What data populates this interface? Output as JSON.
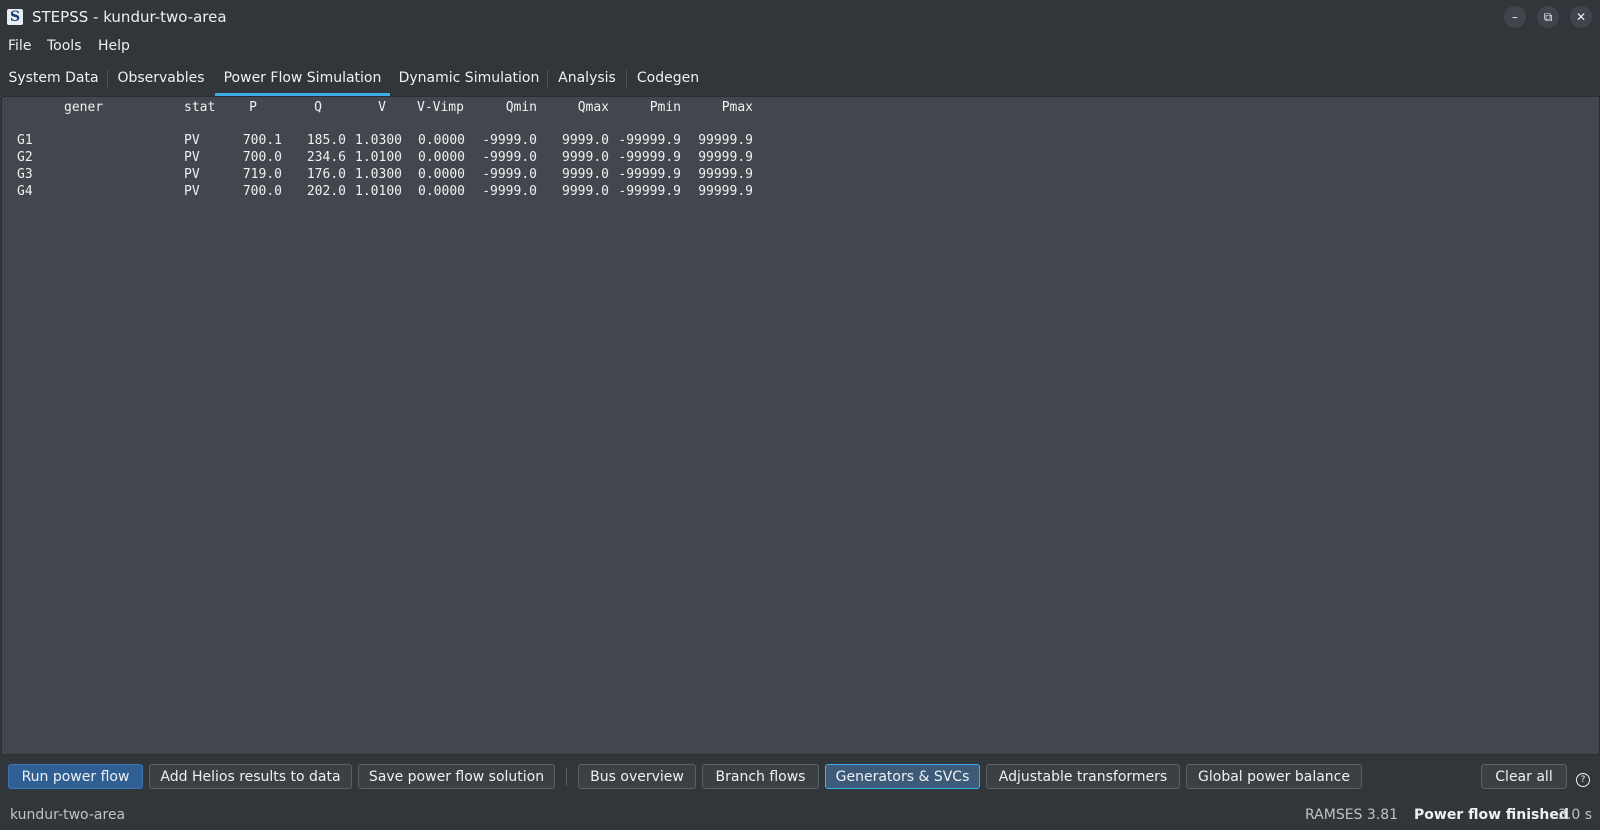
{
  "window": {
    "title": "STEPSS - kundur-two-area",
    "logo_letter": "S",
    "min_glyph": "–",
    "restore_glyph": "⧉",
    "close_glyph": "✕"
  },
  "menu": {
    "items": [
      "File",
      "Tools",
      "Help"
    ]
  },
  "tabs": [
    "System Data",
    "Observables",
    "Power Flow Simulation",
    "Dynamic Simulation",
    "Analysis",
    "Codegen"
  ],
  "active_tab": "Power Flow Simulation",
  "table": {
    "headers": [
      "gener",
      "stat",
      "P",
      "Q",
      "V",
      "V-Vimp",
      "Qmin",
      "Qmax",
      "Pmin",
      "Pmax"
    ],
    "rows": [
      [
        "G1",
        "PV",
        "700.1",
        "185.0",
        "1.0300",
        "0.0000",
        "-9999.0",
        "9999.0",
        "-99999.9",
        "99999.9"
      ],
      [
        "G2",
        "PV",
        "700.0",
        "234.6",
        "1.0100",
        "0.0000",
        "-9999.0",
        "9999.0",
        "-99999.9",
        "99999.9"
      ],
      [
        "G3",
        "PV",
        "719.0",
        "176.0",
        "1.0300",
        "0.0000",
        "-9999.0",
        "9999.0",
        "-99999.9",
        "99999.9"
      ],
      [
        "G4",
        "PV",
        "700.0",
        "202.0",
        "1.0100",
        "0.0000",
        "-9999.0",
        "9999.0",
        "-99999.9",
        "99999.9"
      ]
    ]
  },
  "buttons": {
    "run": "Run power flow",
    "add_helios": "Add Helios results to data",
    "save_solution": "Save power flow solution",
    "bus_overview": "Bus overview",
    "branch_flows": "Branch flows",
    "generators_svcs": "Generators & SVCs",
    "adjustable_transformers": "Adjustable transformers",
    "global_power_balance": "Global power balance",
    "clear_all": "Clear all",
    "help": "?"
  },
  "status": {
    "project": "kundur-two-area",
    "version": "RAMSES 3.81",
    "message": "Power flow finished",
    "time": "3.0 s"
  },
  "colors": {
    "accent": "#3daee9",
    "background": "#31363b",
    "panel": "#42474d"
  }
}
